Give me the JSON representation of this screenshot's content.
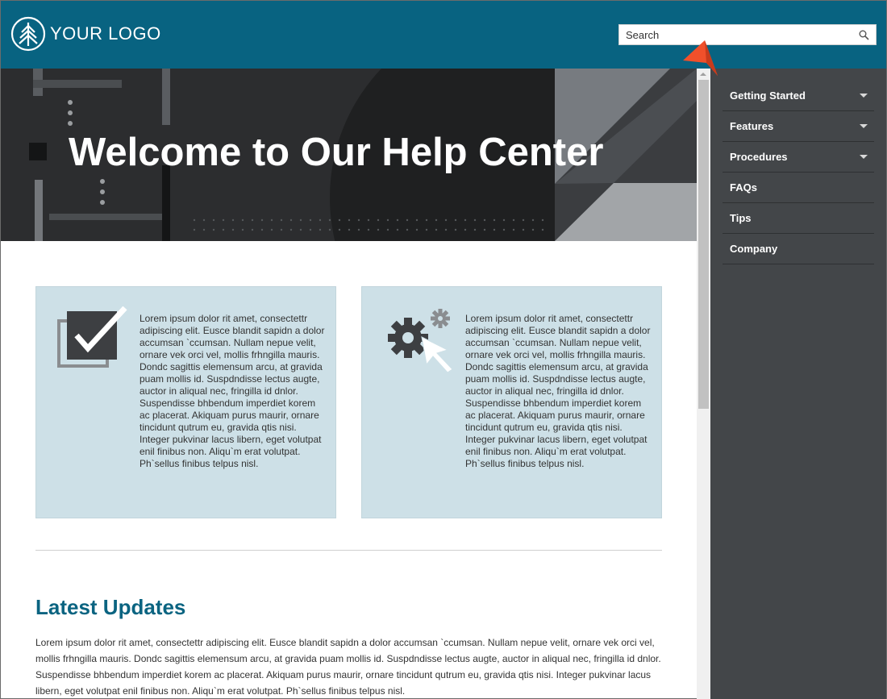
{
  "header": {
    "logo_text": "YOUR LOGO",
    "search_placeholder": "Search",
    "background": "#086381"
  },
  "hero": {
    "title": "Welcome to Our Help Center"
  },
  "sidebar": {
    "items": [
      {
        "label": "Getting Started",
        "has_submenu": true
      },
      {
        "label": "Features",
        "has_submenu": true
      },
      {
        "label": "Procedures",
        "has_submenu": true
      },
      {
        "label": "FAQs",
        "has_submenu": false
      },
      {
        "label": "Tips",
        "has_submenu": false
      },
      {
        "label": "Company",
        "has_submenu": false
      }
    ]
  },
  "cards": [
    {
      "icon": "checkbox-icon",
      "text": "Lorem ipsum dolor rit amet, consectettr adipiscing elit. Eusce blandit sapidn a dolor accumsan `ccumsan. Nullam nepue velit, ornare vek orci vel, mollis frhngilla mauris. Dondc sagittis elemensum arcu, at gravida puam mollis id. Suspdndisse lectus augte, auctor in aliqual nec, fringilla id dnlor. Suspendisse bhbendum imperdiet korem ac placerat. Akiquam purus maurir, ornare tincidunt qutrum eu, gravida qtis nisi. Integer pukvinar lacus libern, eget volutpat enil finibus non. Aliqu`m erat volutpat. Ph`sellus finibus telpus nisl."
    },
    {
      "icon": "gears-cursor-icon",
      "text": "Lorem ipsum dolor rit amet, consectettr adipiscing elit. Eusce blandit sapidn a dolor accumsan `ccumsan. Nullam nepue velit, ornare vek orci vel, mollis frhngilla mauris. Dondc sagittis elemensum arcu, at gravida puam mollis id. Suspdndisse lectus augte, auctor in aliqual nec, fringilla id dnlor. Suspendisse bhbendum imperdiet korem ac placerat. Akiquam purus maurir, ornare tincidunt qutrum eu, gravida qtis nisi. Integer pukvinar lacus libern, eget volutpat enil finibus non. Aliqu`m erat volutpat. Ph`sellus finibus telpus nisl."
    }
  ],
  "updates": {
    "title": "Latest Updates",
    "body": "Lorem ipsum dolor rit amet, consectettr adipiscing elit. Eusce blandit sapidn a dolor accumsan `ccumsan. Nullam nepue velit, ornare vek orci vel, mollis frhngilla mauris. Dondc sagittis elemensum arcu, at gravida puam mollis id. Suspdndisse lectus augte, auctor in aliqual nec, fringilla id dnlor. Suspendisse bhbendum imperdiet korem ac placerat. Akiquam purus maurir, ornare tincidunt qutrum eu, gravida qtis nisi. Integer pukvinar lacus libern, eget volutpat enil finibus non. Aliqu`m erat volutpat. Ph`sellus finibus telpus nisl."
  },
  "colors": {
    "accent": "#086381",
    "sidebar": "#434649",
    "card": "#cde0e7",
    "pointer": "#f0502b"
  }
}
